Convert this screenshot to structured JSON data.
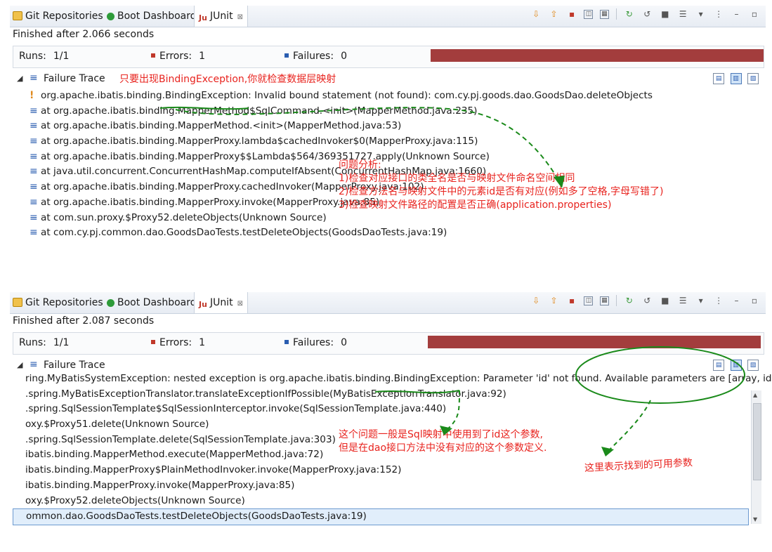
{
  "tabs": {
    "git_repositories": "Git Repositories",
    "boot_dashboard": "Boot Dashboard",
    "junit": "JUnit",
    "junit_close": "⊠"
  },
  "icons": {
    "git_repositories": "git-repo-icon",
    "boot_dashboard": "boot-dashboard-icon",
    "junit": "junit-icon",
    "failure_trace": "failure-trace-icon",
    "stack_frame": "stack-frame-icon",
    "exception": "exception-icon"
  },
  "colors": {
    "error_bar": "#a33d3d",
    "annotation_red": "#e8231e",
    "annotation_green": "#1a8a1a"
  },
  "panel1": {
    "status": "Finished after 2.066 seconds",
    "runs_label": "Runs:",
    "runs_value": "1/1",
    "errors_label": "Errors:",
    "errors_value": "1",
    "failures_label": "Failures:",
    "failures_value": "0",
    "progress_failed": 1.0,
    "failure_trace_label": "Failure Trace",
    "header_note": "只要出现BindingException,你就检查数据层映射",
    "trace": [
      "org.apache.ibatis.binding.BindingException: Invalid bound statement (not found): com.cy.pj.goods.dao.GoodsDao.deleteObjects",
      "at org.apache.ibatis.binding.MapperMethod$SqlCommand.<init>(MapperMethod.java:235)",
      "at org.apache.ibatis.binding.MapperMethod.<init>(MapperMethod.java:53)",
      "at org.apache.ibatis.binding.MapperProxy.lambda$cachedInvoker$0(MapperProxy.java:115)",
      "at org.apache.ibatis.binding.MapperProxy$$Lambda$564/369351727.apply(Unknown Source)",
      "at java.util.concurrent.ConcurrentHashMap.computeIfAbsent(ConcurrentHashMap.java:1660)",
      "at org.apache.ibatis.binding.MapperProxy.cachedInvoker(MapperProxy.java:102)",
      "at org.apache.ibatis.binding.MapperProxy.invoke(MapperProxy.java:85)",
      "at com.sun.proxy.$Proxy52.deleteObjects(Unknown Source)",
      "at com.cy.pj.common.dao.GoodsDaoTests.testDeleteObjects(GoodsDaoTests.java:19)"
    ],
    "analysis_title": "问题分析:",
    "analysis_lines": [
      "1)检查对应接口的类全名是否与映射文件命名空间相同",
      "2)检查方法名与映射文件中的元素id是否有对应(例如多了空格,字母写错了)",
      "3)检查映射文件路径的配置是否正确(application.properties)"
    ]
  },
  "panel2": {
    "status": "Finished after 2.087 seconds",
    "runs_label": "Runs:",
    "runs_value": "1/1",
    "errors_label": "Errors:",
    "errors_value": "1",
    "failures_label": "Failures:",
    "failures_value": "0",
    "progress_failed": 1.0,
    "failure_trace_label": "Failure Trace",
    "trace": [
      "ring.MyBatisSystemException: nested exception is org.apache.ibatis.binding.BindingException: Parameter 'id' not found. Available parameters are [array, ids]",
      ".spring.MyBatisExceptionTranslator.translateExceptionIfPossible(MyBatisExceptionTranslator.java:92)",
      ".spring.SqlSessionTemplate$SqlSessionInterceptor.invoke(SqlSessionTemplate.java:440)",
      "oxy.$Proxy51.delete(Unknown Source)",
      ".spring.SqlSessionTemplate.delete(SqlSessionTemplate.java:303)",
      "ibatis.binding.MapperMethod.execute(MapperMethod.java:72)",
      "ibatis.binding.MapperProxy$PlainMethodInvoker.invoke(MapperProxy.java:152)",
      "ibatis.binding.MapperProxy.invoke(MapperProxy.java:85)",
      "oxy.$Proxy52.deleteObjects(Unknown Source)",
      "ommon.dao.GoodsDaoTests.testDeleteObjects(GoodsDaoTests.java:19)"
    ],
    "note1_lines": [
      "这个问题一般是Sql映射中使用到了id这个参数,",
      "但是在dao接口方法中没有对应的这个参数定义."
    ],
    "note2": "这里表示找到的可用参数"
  }
}
